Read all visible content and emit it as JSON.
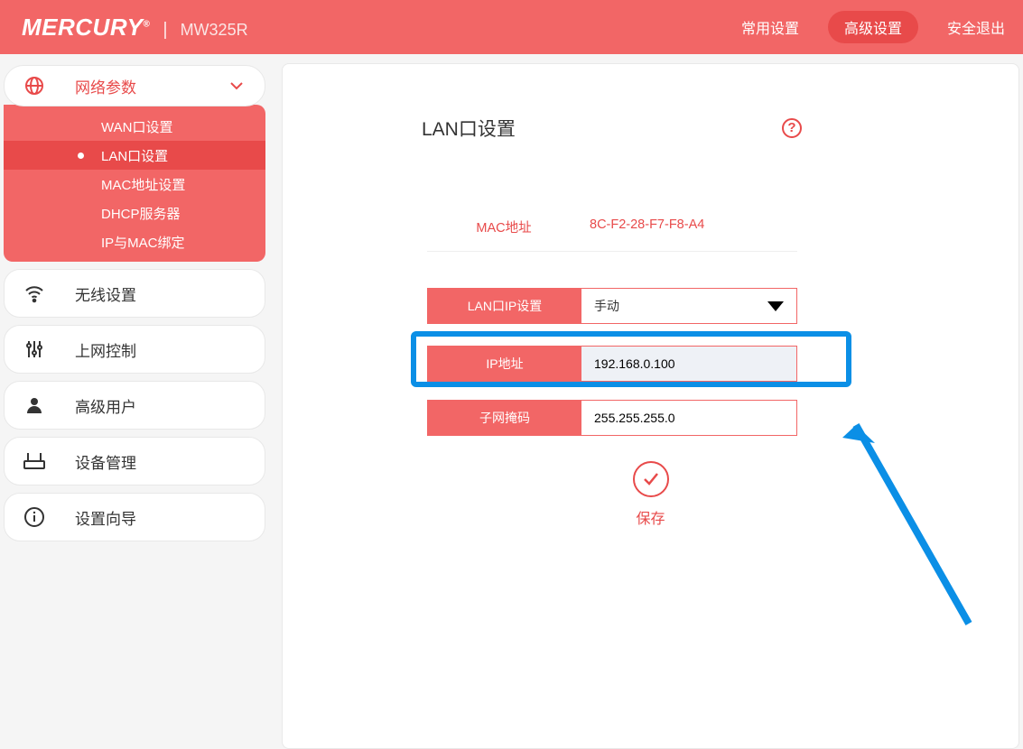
{
  "header": {
    "brand": "MERCURY",
    "model": "MW325R",
    "nav_common": "常用设置",
    "nav_advanced": "高级设置",
    "nav_logout": "安全退出"
  },
  "sidebar": {
    "network_params": "网络参数",
    "sub": {
      "wan": "WAN口设置",
      "lan": "LAN口设置",
      "mac": "MAC地址设置",
      "dhcp": "DHCP服务器",
      "ipmac": "IP与MAC绑定"
    },
    "wireless": "无线设置",
    "access_control": "上网控制",
    "advanced_users": "高级用户",
    "device_mgmt": "设备管理",
    "setup_wizard": "设置向导"
  },
  "panel": {
    "title": "LAN口设置",
    "mac_label": "MAC地址",
    "mac_value": "8C-F2-28-F7-F8-A4",
    "lan_ip_label": "LAN口IP设置",
    "lan_ip_mode": "手动",
    "ip_label": "IP地址",
    "ip_value": "192.168.0.100",
    "mask_label": "子网掩码",
    "mask_value": "255.255.255.0",
    "save": "保存"
  }
}
